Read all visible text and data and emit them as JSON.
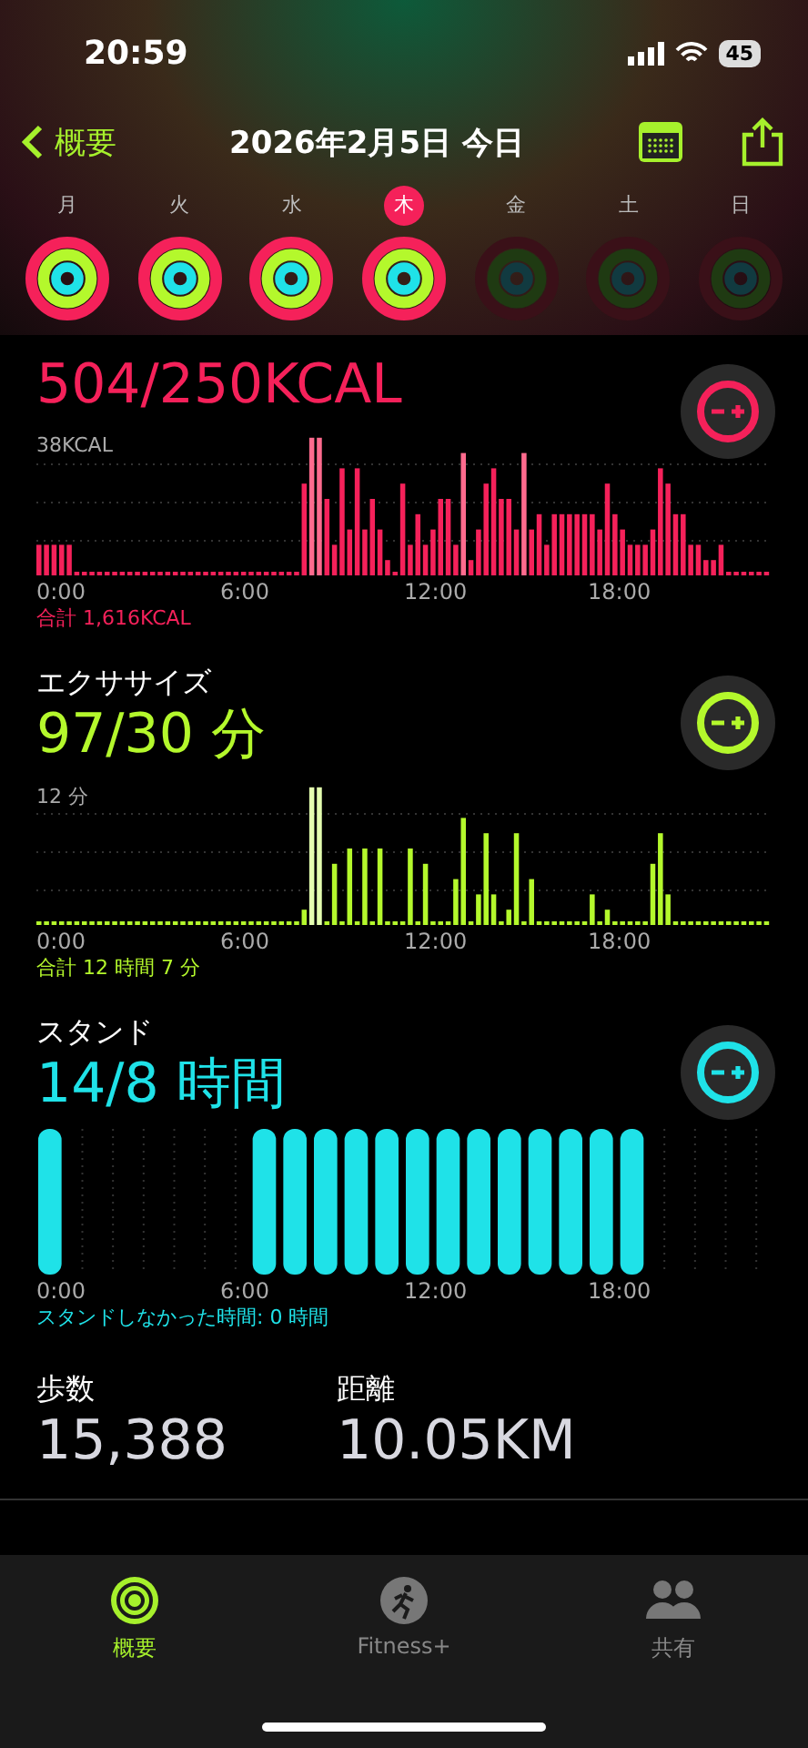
{
  "status_bar": {
    "time": "20:59",
    "battery": "45"
  },
  "nav": {
    "back": "概要",
    "title": "2026年2月5日 今日"
  },
  "week": [
    {
      "day": "月",
      "selected": false,
      "completed": true
    },
    {
      "day": "火",
      "selected": false,
      "completed": true
    },
    {
      "day": "水",
      "selected": false,
      "completed": true
    },
    {
      "day": "木",
      "selected": true,
      "completed": true
    },
    {
      "day": "金",
      "selected": false,
      "completed": false
    },
    {
      "day": "土",
      "selected": false,
      "completed": false
    },
    {
      "day": "日",
      "selected": false,
      "completed": false
    }
  ],
  "rings": [
    {
      "kind": "move",
      "value": "504/250KCAL",
      "color": "#f5215a",
      "max_label": "38KCAL",
      "x_labels": [
        "0:00",
        "6:00",
        "12:00",
        "18:00"
      ],
      "total": "合計 1,616KCAL"
    },
    {
      "kind": "exercise",
      "label": "エクササイズ",
      "value": "97/30 分",
      "color": "#b4f82c",
      "max_label": "12 分",
      "x_labels": [
        "0:00",
        "6:00",
        "12:00",
        "18:00"
      ],
      "total": "合計 12 時間 7 分"
    },
    {
      "kind": "stand",
      "label": "スタンド",
      "value": "14/8 時間",
      "color": "#1fe2e8",
      "x_labels": [
        "0:00",
        "6:00",
        "12:00",
        "18:00"
      ],
      "total": "スタンドしなかった時間: 0 時間"
    }
  ],
  "stats": [
    {
      "label": "歩数",
      "value": "15,388"
    },
    {
      "label": "距離",
      "value": "10.05KM"
    }
  ],
  "tabs": [
    {
      "label": "概要",
      "selected": true
    },
    {
      "label": "Fitness+",
      "selected": false
    },
    {
      "label": "共有",
      "selected": false
    }
  ]
}
